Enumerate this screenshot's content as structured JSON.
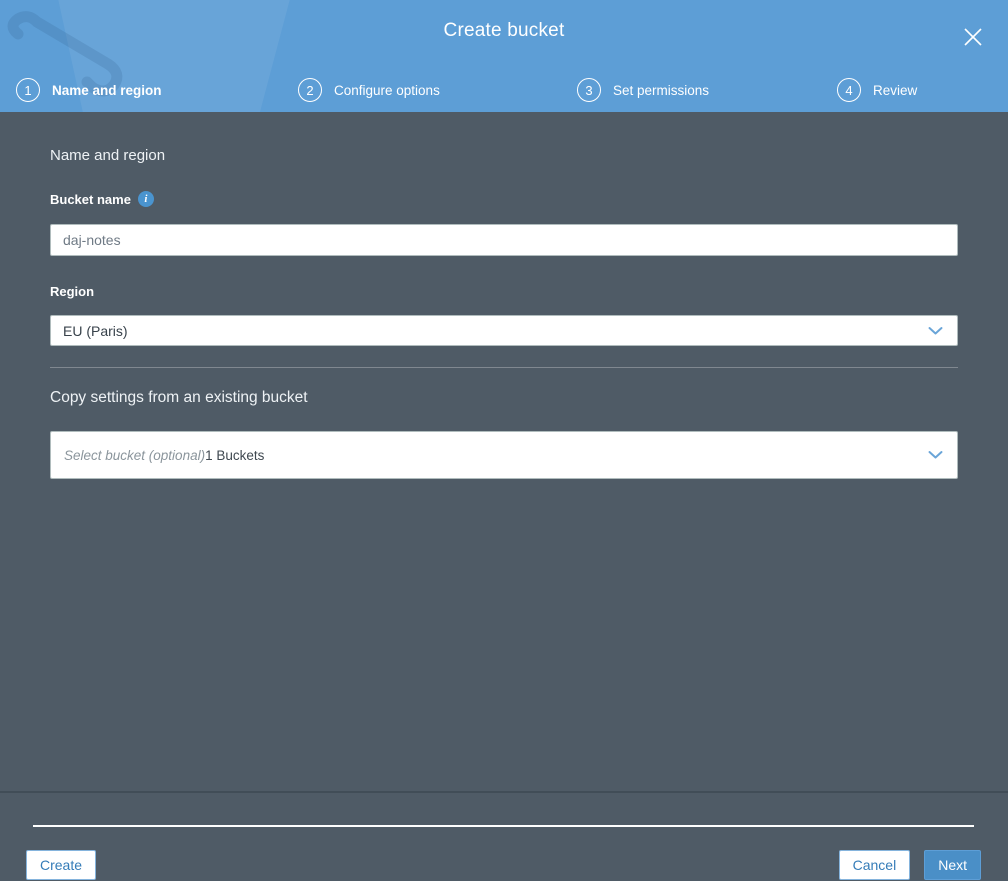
{
  "modal": {
    "title": "Create bucket"
  },
  "steps": [
    {
      "number": "1",
      "label": "Name and region"
    },
    {
      "number": "2",
      "label": "Configure options"
    },
    {
      "number": "3",
      "label": "Set permissions"
    },
    {
      "number": "4",
      "label": "Review"
    }
  ],
  "form": {
    "section_heading": "Name and region",
    "bucket_name": {
      "label": "Bucket name",
      "info_icon": "i",
      "value": "daj-notes"
    },
    "region": {
      "label": "Region",
      "selected": "EU (Paris)"
    },
    "copy_settings": {
      "heading": "Copy settings from an existing bucket",
      "placeholder": "Select bucket (optional)",
      "bucket_count": "1 Buckets"
    }
  },
  "footer": {
    "create_label": "Create",
    "cancel_label": "Cancel",
    "next_label": "Next"
  },
  "colors": {
    "header_blue": "#5d9ed6",
    "body_slate": "#4f5b66",
    "accent_blue": "#4a8fc7",
    "link_blue": "#357cb8"
  }
}
